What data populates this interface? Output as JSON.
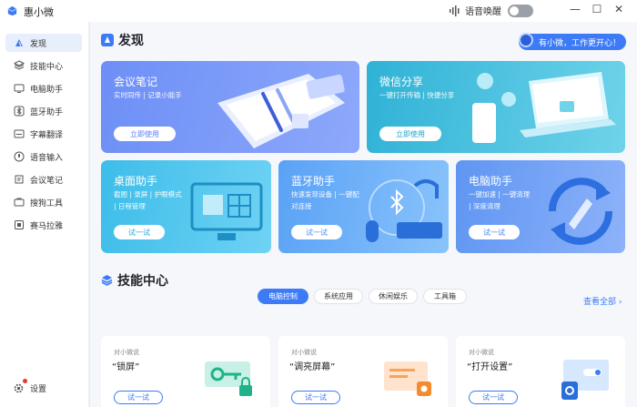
{
  "app": {
    "name": "惠小微",
    "voice_wake_label": "语音唤醒",
    "voice_wake_on": false
  },
  "window_controls": {
    "minimize": "—",
    "maximize": "☐",
    "close": "✕"
  },
  "sidebar": {
    "items": [
      {
        "label": "发现",
        "icon": "discover-icon",
        "active": true
      },
      {
        "label": "技能中心",
        "icon": "cube-icon"
      },
      {
        "label": "电脑助手",
        "icon": "computer-icon"
      },
      {
        "label": "蓝牙助手",
        "icon": "bluetooth-icon"
      },
      {
        "label": "字幕翻译",
        "icon": "subtitle-icon"
      },
      {
        "label": "语音输入",
        "icon": "microphone-icon"
      },
      {
        "label": "会议笔记",
        "icon": "note-icon"
      },
      {
        "label": "搜狗工具",
        "icon": "tool-icon"
      },
      {
        "label": "赛马拉雅",
        "icon": "app-icon"
      }
    ],
    "settings_label": "设置"
  },
  "discover": {
    "title": "发现",
    "greeting": "有小微，工作更开心！",
    "cards": [
      {
        "title": "会议笔记",
        "subtitle": [
          "实时同传 | 记录小能手"
        ],
        "button": "立即使用",
        "color": "#6b8ff5"
      },
      {
        "title": "微信分享",
        "subtitle": [
          "一键打开传输 | 快捷分享"
        ],
        "button": "立即使用",
        "color": "#37b6d8"
      },
      {
        "title": "桌面助手",
        "subtitle": [
          "截图 | 录屏 | 护眼模式",
          "| 日程管理"
        ],
        "button": "试一试",
        "color": "#47c4ee"
      },
      {
        "title": "蓝牙助手",
        "subtitle": [
          "快速发现设备 | 一键配",
          "对连接"
        ],
        "button": "试一试",
        "color": "#5b9ff6"
      },
      {
        "title": "电脑助手",
        "subtitle": [
          "一键加速 | 一键清理",
          "| 深度清理"
        ],
        "button": "试一试",
        "color": "#6f9df6"
      }
    ]
  },
  "skills": {
    "title": "技能中心",
    "view_all": "查看全部 ›",
    "tabs": [
      {
        "label": "电脑控制",
        "active": true
      },
      {
        "label": "系统应用"
      },
      {
        "label": "休闲娱乐"
      },
      {
        "label": "工具箱"
      }
    ],
    "cards": [
      {
        "label": "对小微说",
        "command": "“锁屏”",
        "button": "试一试"
      },
      {
        "label": "对小微说",
        "command": "“调亮屏幕”",
        "button": "试一试"
      },
      {
        "label": "对小微说",
        "command": "“打开设置”",
        "button": "试一试"
      }
    ]
  }
}
